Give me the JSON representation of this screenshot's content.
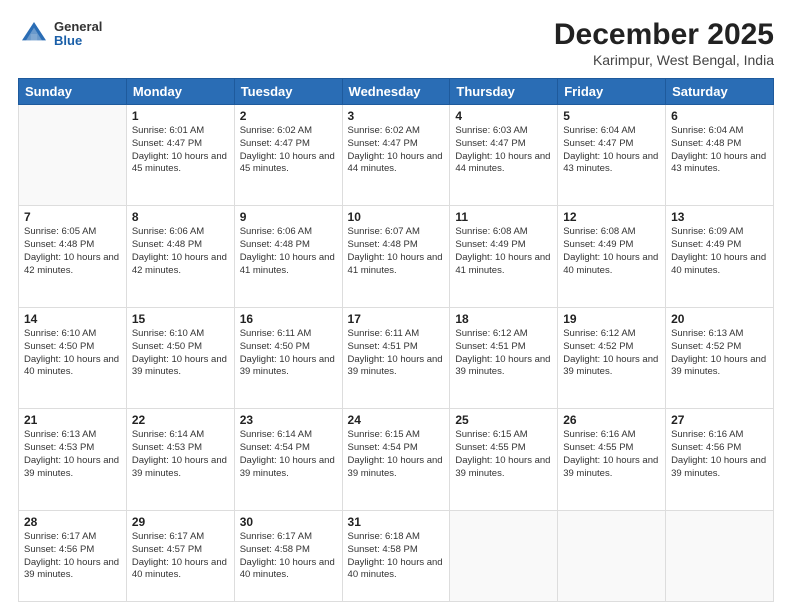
{
  "header": {
    "logo": {
      "general": "General",
      "blue": "Blue"
    },
    "title": "December 2025",
    "subtitle": "Karimpur, West Bengal, India"
  },
  "calendar": {
    "days_of_week": [
      "Sunday",
      "Monday",
      "Tuesday",
      "Wednesday",
      "Thursday",
      "Friday",
      "Saturday"
    ],
    "weeks": [
      [
        {
          "day": "",
          "info": ""
        },
        {
          "day": "1",
          "info": "Sunrise: 6:01 AM\nSunset: 4:47 PM\nDaylight: 10 hours\nand 45 minutes."
        },
        {
          "day": "2",
          "info": "Sunrise: 6:02 AM\nSunset: 4:47 PM\nDaylight: 10 hours\nand 45 minutes."
        },
        {
          "day": "3",
          "info": "Sunrise: 6:02 AM\nSunset: 4:47 PM\nDaylight: 10 hours\nand 44 minutes."
        },
        {
          "day": "4",
          "info": "Sunrise: 6:03 AM\nSunset: 4:47 PM\nDaylight: 10 hours\nand 44 minutes."
        },
        {
          "day": "5",
          "info": "Sunrise: 6:04 AM\nSunset: 4:47 PM\nDaylight: 10 hours\nand 43 minutes."
        },
        {
          "day": "6",
          "info": "Sunrise: 6:04 AM\nSunset: 4:48 PM\nDaylight: 10 hours\nand 43 minutes."
        }
      ],
      [
        {
          "day": "7",
          "info": "Sunrise: 6:05 AM\nSunset: 4:48 PM\nDaylight: 10 hours\nand 42 minutes."
        },
        {
          "day": "8",
          "info": "Sunrise: 6:06 AM\nSunset: 4:48 PM\nDaylight: 10 hours\nand 42 minutes."
        },
        {
          "day": "9",
          "info": "Sunrise: 6:06 AM\nSunset: 4:48 PM\nDaylight: 10 hours\nand 41 minutes."
        },
        {
          "day": "10",
          "info": "Sunrise: 6:07 AM\nSunset: 4:48 PM\nDaylight: 10 hours\nand 41 minutes."
        },
        {
          "day": "11",
          "info": "Sunrise: 6:08 AM\nSunset: 4:49 PM\nDaylight: 10 hours\nand 41 minutes."
        },
        {
          "day": "12",
          "info": "Sunrise: 6:08 AM\nSunset: 4:49 PM\nDaylight: 10 hours\nand 40 minutes."
        },
        {
          "day": "13",
          "info": "Sunrise: 6:09 AM\nSunset: 4:49 PM\nDaylight: 10 hours\nand 40 minutes."
        }
      ],
      [
        {
          "day": "14",
          "info": "Sunrise: 6:10 AM\nSunset: 4:50 PM\nDaylight: 10 hours\nand 40 minutes."
        },
        {
          "day": "15",
          "info": "Sunrise: 6:10 AM\nSunset: 4:50 PM\nDaylight: 10 hours\nand 39 minutes."
        },
        {
          "day": "16",
          "info": "Sunrise: 6:11 AM\nSunset: 4:50 PM\nDaylight: 10 hours\nand 39 minutes."
        },
        {
          "day": "17",
          "info": "Sunrise: 6:11 AM\nSunset: 4:51 PM\nDaylight: 10 hours\nand 39 minutes."
        },
        {
          "day": "18",
          "info": "Sunrise: 6:12 AM\nSunset: 4:51 PM\nDaylight: 10 hours\nand 39 minutes."
        },
        {
          "day": "19",
          "info": "Sunrise: 6:12 AM\nSunset: 4:52 PM\nDaylight: 10 hours\nand 39 minutes."
        },
        {
          "day": "20",
          "info": "Sunrise: 6:13 AM\nSunset: 4:52 PM\nDaylight: 10 hours\nand 39 minutes."
        }
      ],
      [
        {
          "day": "21",
          "info": "Sunrise: 6:13 AM\nSunset: 4:53 PM\nDaylight: 10 hours\nand 39 minutes."
        },
        {
          "day": "22",
          "info": "Sunrise: 6:14 AM\nSunset: 4:53 PM\nDaylight: 10 hours\nand 39 minutes."
        },
        {
          "day": "23",
          "info": "Sunrise: 6:14 AM\nSunset: 4:54 PM\nDaylight: 10 hours\nand 39 minutes."
        },
        {
          "day": "24",
          "info": "Sunrise: 6:15 AM\nSunset: 4:54 PM\nDaylight: 10 hours\nand 39 minutes."
        },
        {
          "day": "25",
          "info": "Sunrise: 6:15 AM\nSunset: 4:55 PM\nDaylight: 10 hours\nand 39 minutes."
        },
        {
          "day": "26",
          "info": "Sunrise: 6:16 AM\nSunset: 4:55 PM\nDaylight: 10 hours\nand 39 minutes."
        },
        {
          "day": "27",
          "info": "Sunrise: 6:16 AM\nSunset: 4:56 PM\nDaylight: 10 hours\nand 39 minutes."
        }
      ],
      [
        {
          "day": "28",
          "info": "Sunrise: 6:17 AM\nSunset: 4:56 PM\nDaylight: 10 hours\nand 39 minutes."
        },
        {
          "day": "29",
          "info": "Sunrise: 6:17 AM\nSunset: 4:57 PM\nDaylight: 10 hours\nand 40 minutes."
        },
        {
          "day": "30",
          "info": "Sunrise: 6:17 AM\nSunset: 4:58 PM\nDaylight: 10 hours\nand 40 minutes."
        },
        {
          "day": "31",
          "info": "Sunrise: 6:18 AM\nSunset: 4:58 PM\nDaylight: 10 hours\nand 40 minutes."
        },
        {
          "day": "",
          "info": ""
        },
        {
          "day": "",
          "info": ""
        },
        {
          "day": "",
          "info": ""
        }
      ]
    ]
  }
}
